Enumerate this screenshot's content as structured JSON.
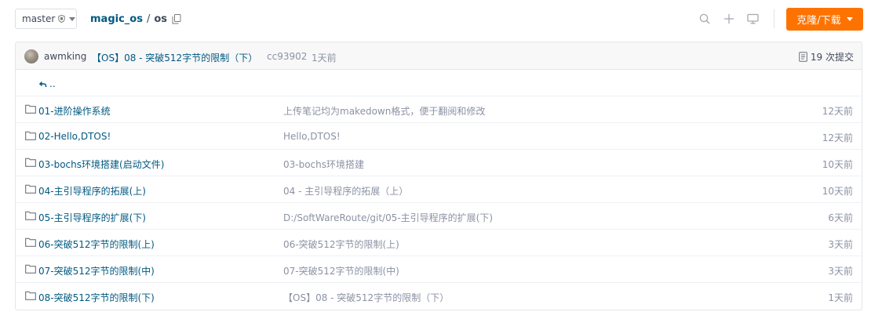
{
  "header": {
    "branch": "master",
    "repo": "magic_os",
    "separator": "/",
    "directory": "os",
    "clone_label": "克隆/下载"
  },
  "commit": {
    "author": "awmking",
    "message": "【OS】08 - 突破512字节的限制（下）",
    "hash": "cc93902",
    "time": "1天前",
    "count_label": "19 次提交"
  },
  "parent_link": "..",
  "files": [
    {
      "name": "01-进阶操作系统",
      "message": "上传笔记均为makedown格式，便于翻阅和修改",
      "date": "12天前"
    },
    {
      "name": "02-Hello,DTOS!",
      "message": "Hello,DTOS!",
      "date": "12天前"
    },
    {
      "name": "03-bochs环境搭建(启动文件)",
      "message": "03-bochs环境搭建",
      "date": "10天前"
    },
    {
      "name": "04-主引导程序的拓展(上)",
      "message": "04 - 主引导程序的拓展（上）",
      "date": "10天前"
    },
    {
      "name": "05-主引导程序的扩展(下)",
      "message": "D:/SoftWareRoute/git/05-主引导程序的扩展(下)",
      "date": "6天前"
    },
    {
      "name": "06-突破512字节的限制(上)",
      "message": "06-突破512字节的限制(上)",
      "date": "3天前"
    },
    {
      "name": "07-突破512字节的限制(中)",
      "message": "07-突破512字节的限制(中)",
      "date": "3天前"
    },
    {
      "name": "08-突破512字节的限制(下)",
      "message": "【OS】08 - 突破512字节的限制（下）",
      "date": "1天前"
    }
  ],
  "colors": {
    "accent": "#fe7300",
    "link": "#005980",
    "muted": "#8c92a4"
  }
}
